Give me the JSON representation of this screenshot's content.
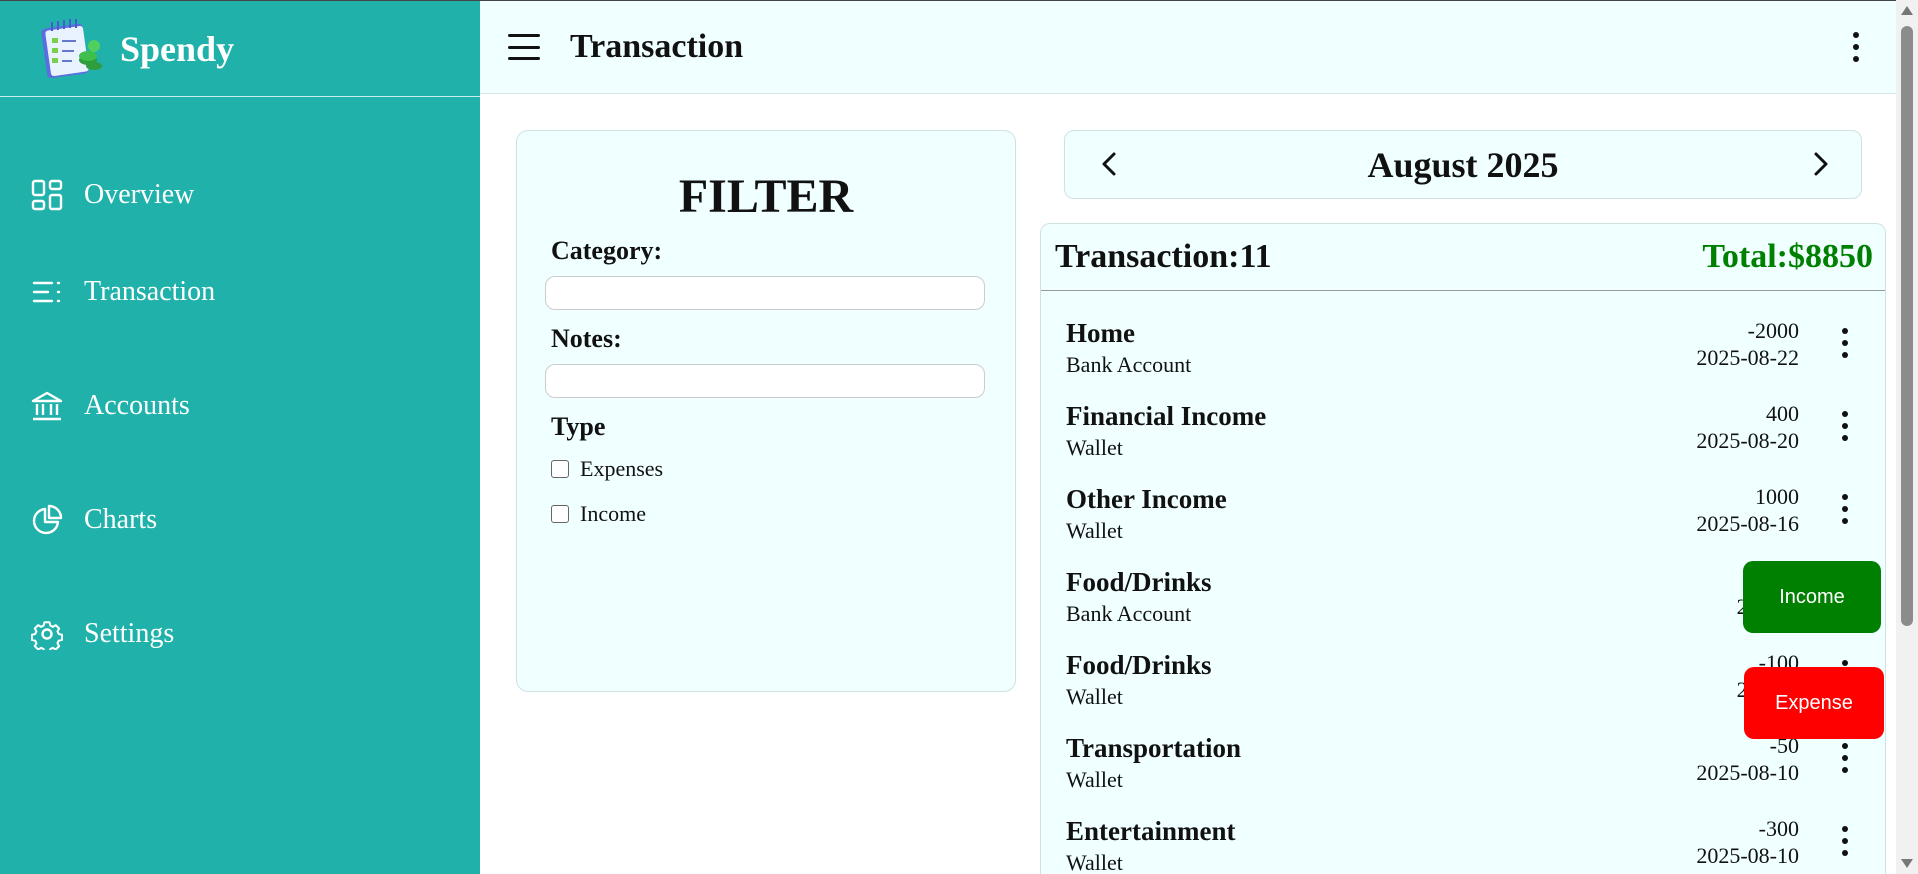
{
  "app": {
    "name": "Spendy"
  },
  "sidebar": {
    "items": [
      {
        "label": "Overview",
        "icon": "grid-icon"
      },
      {
        "label": "Transaction",
        "icon": "list-icon"
      },
      {
        "label": "Accounts",
        "icon": "bank-icon"
      },
      {
        "label": "Charts",
        "icon": "pie-chart-icon"
      },
      {
        "label": "Settings",
        "icon": "gear-icon"
      }
    ]
  },
  "header": {
    "title": "Transaction"
  },
  "filter": {
    "title": "FILTER",
    "category_label": "Category:",
    "category_value": "",
    "notes_label": "Notes:",
    "notes_value": "",
    "type_label": "Type",
    "options": [
      {
        "label": "Expenses",
        "checked": false
      },
      {
        "label": "Income",
        "checked": false
      }
    ]
  },
  "month": {
    "label": "August 2025"
  },
  "transactions": {
    "count_label": "Transaction:11",
    "total_label": "Total:$8850",
    "items": [
      {
        "category": "Home",
        "account": "Bank Account",
        "amount": "-2000",
        "date": "2025-08-22"
      },
      {
        "category": "Financial Income",
        "account": "Wallet",
        "amount": "400",
        "date": "2025-08-20"
      },
      {
        "category": "Other Income",
        "account": "Wallet",
        "amount": "1000",
        "date": "2025-08-16"
      },
      {
        "category": "Food/Drinks",
        "account": "Bank Account",
        "amount": "",
        "date": "2025-0"
      },
      {
        "category": "Food/Drinks",
        "account": "Wallet",
        "amount": "-100",
        "date": "2025-0"
      },
      {
        "category": "Transportation",
        "account": "Wallet",
        "amount": "-50",
        "date": "2025-08-10"
      },
      {
        "category": "Entertainment",
        "account": "Wallet",
        "amount": "-300",
        "date": "2025-08-10"
      }
    ]
  },
  "actions": {
    "income_label": "Income",
    "expense_label": "Expense"
  },
  "colors": {
    "sidebar": "#20b2aa",
    "panel": "#f0ffff",
    "income": "#008000",
    "expense": "#ff0000",
    "total": "#008000"
  }
}
